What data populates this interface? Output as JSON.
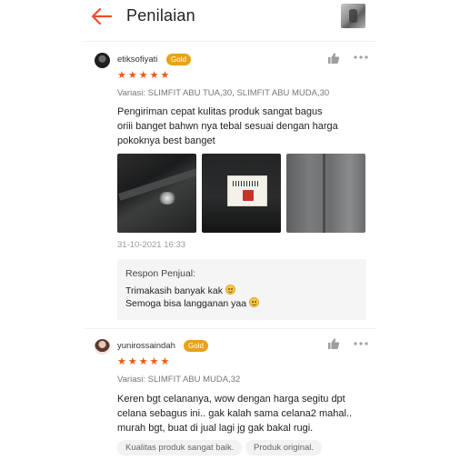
{
  "header": {
    "title": "Penilaian",
    "back_icon": "back-arrow-icon",
    "accent_color": "#ee4d2d"
  },
  "reviews": [
    {
      "username": "etiksofiyati",
      "badge": "Gold",
      "stars": "★★★★★",
      "rating": 5,
      "variant": "Variasi: SLIMFIT ABU TUA,30, SLIMFIT ABU MUDA,30",
      "text_lines": [
        "Pengiriman cepat  kulitas produk sangat bagus",
        "oriii banget bahwn nya tebal sesuai dengan harga",
        "pokoknya best banget"
      ],
      "date": "31-10-2021 16:33",
      "seller_response": {
        "label": "Respon Penjual:",
        "lines": [
          "Trimakasih banyak kak",
          "Semoga bisa langganan yaa"
        ]
      }
    },
    {
      "username": "yunirossaindah",
      "badge": "Gold",
      "stars": "★★★★★",
      "rating": 5,
      "variant": "Variasi: SLIMFIT ABU MUDA,32",
      "text_lines": [
        "Keren bgt celananya, wow dengan harga segitu dpt",
        "celana sebagus ini.. gak kalah sama celana2 mahal..",
        "murah bgt, buat di jual lagi jg gak bakal rugi."
      ],
      "tags": [
        "Kualitas produk sangat baik.",
        "Produk original."
      ]
    }
  ],
  "colors": {
    "star": "#f2570a",
    "badge": "#e8a317",
    "muted_text": "#777777"
  }
}
